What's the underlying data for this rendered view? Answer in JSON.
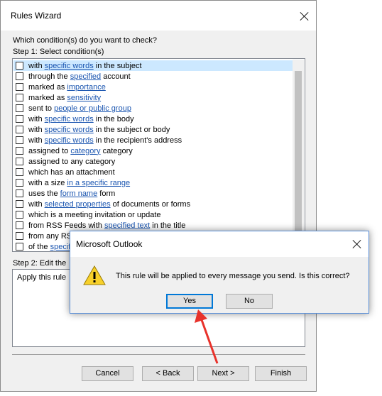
{
  "wizard": {
    "title": "Rules Wizard",
    "question": "Which condition(s) do you want to check?",
    "step1": "Step 1: Select condition(s)",
    "conditions": [
      {
        "pre": "with ",
        "link": "specific words",
        "post": " in the subject",
        "selected": true
      },
      {
        "pre": "through the ",
        "link": "specified",
        "post": " account"
      },
      {
        "pre": "marked as ",
        "link": "importance",
        "post": ""
      },
      {
        "pre": "marked as ",
        "link": "sensitivity",
        "post": ""
      },
      {
        "pre": "sent to ",
        "link": "people or public group",
        "post": ""
      },
      {
        "pre": "with ",
        "link": "specific words",
        "post": " in the body"
      },
      {
        "pre": "with ",
        "link": "specific words",
        "post": " in the subject or body"
      },
      {
        "pre": "with ",
        "link": "specific words",
        "post": " in the recipient's address"
      },
      {
        "pre": "assigned to ",
        "link": "category",
        "post": " category"
      },
      {
        "pre": "assigned to any category",
        "link": "",
        "post": ""
      },
      {
        "pre": "which has an attachment",
        "link": "",
        "post": ""
      },
      {
        "pre": "with a size ",
        "link": "in a specific range",
        "post": ""
      },
      {
        "pre": "uses the ",
        "link": "form name",
        "post": " form"
      },
      {
        "pre": "with ",
        "link": "selected properties",
        "post": " of documents or forms"
      },
      {
        "pre": "which is a meeting invitation or update",
        "link": "",
        "post": ""
      },
      {
        "pre": "from RSS Feeds with ",
        "link": "specified text",
        "post": " in the title"
      },
      {
        "pre": "from any RSS",
        "link": "",
        "post": ""
      },
      {
        "pre": "of the ",
        "link": "specific",
        "post": ""
      }
    ],
    "step2": "Step 2: Edit the",
    "description": "Apply this rule",
    "buttons": {
      "cancel": "Cancel",
      "back": "< Back",
      "next": "Next >",
      "finish": "Finish"
    }
  },
  "messagebox": {
    "title": "Microsoft Outlook",
    "icon": "warning-icon",
    "text": "This rule will be applied to every message you send. Is this correct?",
    "yes": "Yes",
    "no": "No"
  },
  "colors": {
    "link": "#1a55b0",
    "selection": "#cce8ff",
    "default_button": "#0078d7",
    "annotation_arrow": "#e8322b"
  }
}
